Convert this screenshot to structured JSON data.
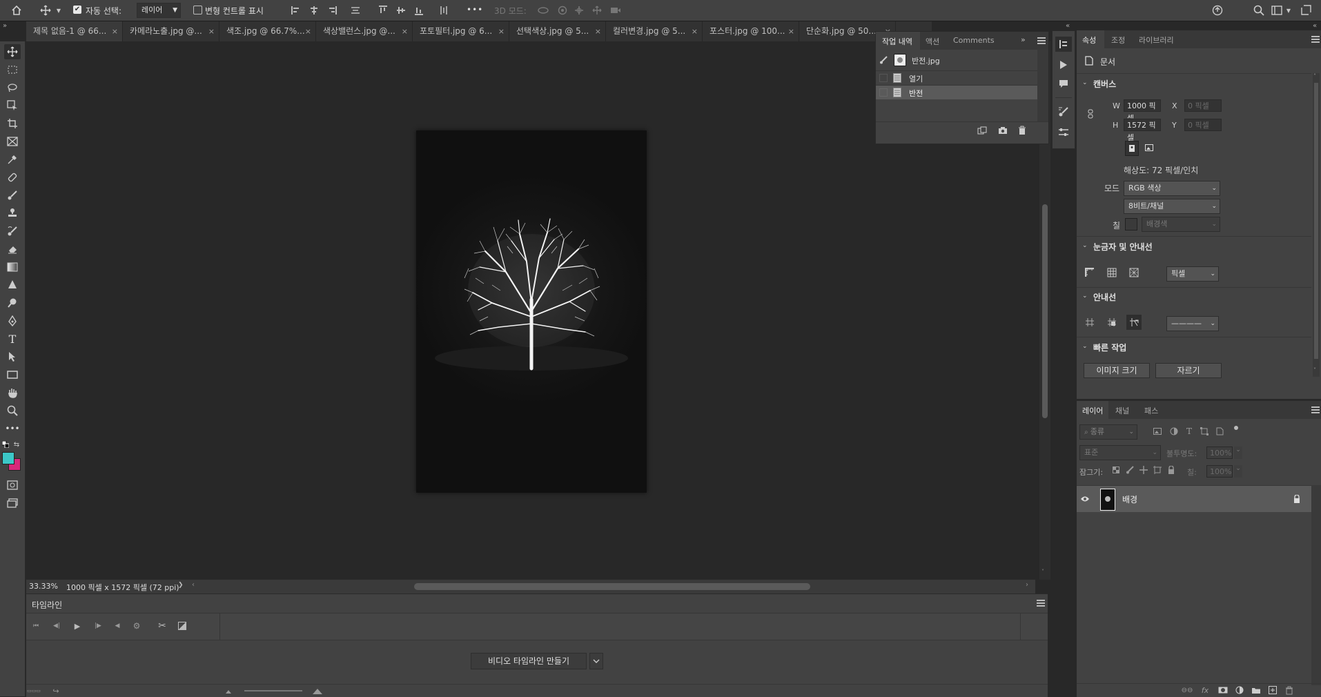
{
  "toolbar": {
    "auto_select_label": "자동 선택:",
    "auto_select_value": "레이어",
    "transform_controls_label": "변형 컨트롤 표시",
    "more": "•••",
    "mode_3d_label": "3D 모드:"
  },
  "tabs": [
    {
      "label": "제목 없음-1 @ 66...",
      "close": "×"
    },
    {
      "label": "카메라노출.jpg @...",
      "close": "×"
    },
    {
      "label": "색조.jpg @ 66.7%...",
      "close": "×"
    },
    {
      "label": "색상밸런스.jpg @...",
      "close": "×"
    },
    {
      "label": "포토필터.jpg @ 6...",
      "close": "×"
    },
    {
      "label": "선택색상.jpg @ 5...",
      "close": "×"
    },
    {
      "label": "컬러변경.jpg @ 5...",
      "close": "×"
    },
    {
      "label": "포스터.jpg @ 100...",
      "close": "×"
    },
    {
      "label": "단순화.jpg @ 50...",
      "close": "×"
    }
  ],
  "colors": {
    "foreground": "#3cc8c8",
    "background": "#d8287a",
    "panel": "#424242",
    "canvas_bg": "#282828",
    "selected_row": "#5a5a5a"
  },
  "status": {
    "zoom": "33.33%",
    "doc_info": "1000 픽셀 x 1572 픽셀 (72 ppi)",
    "arrow": "❯"
  },
  "history": {
    "tabs": [
      "작업 내역",
      "액션",
      "Comments"
    ],
    "snapshot": "반전.jpg",
    "items": [
      "열기",
      "반전"
    ]
  },
  "properties": {
    "tabs": [
      "속성",
      "조정",
      "라이브러리"
    ],
    "doc_label": "문서",
    "canvas_section": "캔버스",
    "w_label": "W",
    "w_value": "1000 픽셀",
    "h_label": "H",
    "h_value": "1572 픽셀",
    "x_label": "X",
    "x_value": "0 픽셀",
    "y_label": "Y",
    "y_value": "0 픽셀",
    "resolution": "해상도: 72 픽셀/인치",
    "mode_label": "모드",
    "mode_value": "RGB 색상",
    "bit_value": "8비트/채널",
    "fill_label": "칠",
    "fill_value": "배경색",
    "rulers_section": "눈금자 및 안내선",
    "ruler_unit": "픽셀",
    "guides_section": "안내선",
    "guide_line": "————",
    "quick_section": "빠른 작업",
    "image_size_button": "이미지 크기",
    "crop_button": "자르기"
  },
  "layers": {
    "tabs": [
      "레이어",
      "채널",
      "패스"
    ],
    "filter_label": "종류",
    "blend_mode": "표준",
    "opacity_label": "불투명도:",
    "opacity_value": "100%",
    "lock_label": "잠그기:",
    "fill_label": "칠:",
    "fill_value": "100%",
    "layer_name": "배경"
  },
  "timeline": {
    "title": "타임라인",
    "create_button": "비디오 타임라인 만들기"
  }
}
